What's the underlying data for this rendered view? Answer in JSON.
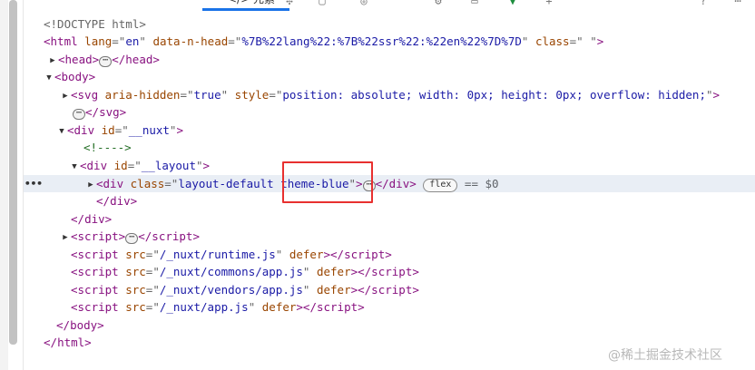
{
  "toolbar": {
    "active_tab_label": "元素",
    "active_tab_prefix": "</>"
  },
  "tree": {
    "doctype": "<!DOCTYPE html>",
    "html_open": {
      "tag": "html",
      "attrs": [
        {
          "name": "lang",
          "value": "en"
        },
        {
          "name": "data-n-head",
          "value": "%7B%22lang%22:%7B%22ssr%22:%22en%22%7D%7D"
        },
        {
          "name": "class",
          "value": " "
        }
      ]
    },
    "head": "head",
    "body": "body",
    "svg": {
      "tag": "svg",
      "attrs": [
        {
          "name": "aria-hidden",
          "value": "true"
        },
        {
          "name": "style",
          "value": "position: absolute; width: 0px; height: 0px; overflow: hidden;"
        }
      ]
    },
    "nuxt_div": {
      "tag": "div",
      "attr": "id",
      "value": "__nuxt"
    },
    "comment": "<!---->",
    "layout_div": {
      "tag": "div",
      "attr": "id",
      "value": "__layout"
    },
    "selected_div": {
      "tag": "div",
      "attr": "class",
      "value": "layout-default theme-blue",
      "badge": "flex",
      "console_ref": "== $0"
    },
    "scripts": [
      "/_nuxt/runtime.js",
      "/_nuxt/commons/app.js",
      "/_nuxt/vendors/app.js",
      "/_nuxt/app.js"
    ],
    "defer": "defer"
  },
  "watermark": "@稀土掘金技术社区",
  "colors": {
    "tag": "#881280",
    "attr": "#994500",
    "value": "#1a1aa6",
    "highlight": "#e8302f",
    "selection": "#e9eef5"
  }
}
